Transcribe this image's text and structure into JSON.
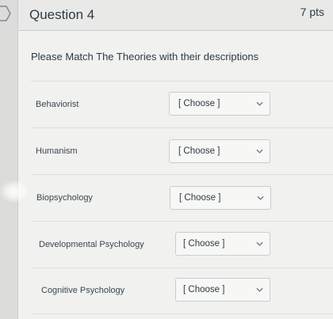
{
  "question": {
    "title": "Question 4",
    "points": "7 pts",
    "prompt": "Please Match The Theories with their descriptions"
  },
  "matches": [
    {
      "term": "Behaviorist",
      "selected": "[ Choose ]"
    },
    {
      "term": "Humanism",
      "selected": "[ Choose ]"
    },
    {
      "term": "Biopsychology",
      "selected": "[ Choose ]"
    },
    {
      "term": "Developmental Psychology",
      "selected": "[ Choose ]"
    },
    {
      "term": "Cognitive Psychology",
      "selected": "[ Choose ]"
    }
  ],
  "icons": {
    "previous": "chevron-right-outline-icon",
    "dropdown": "chevron-down-icon"
  },
  "colors": {
    "page_background": "#f1f1ef",
    "text": "#2d3b45",
    "border": "#c7cdd1"
  }
}
